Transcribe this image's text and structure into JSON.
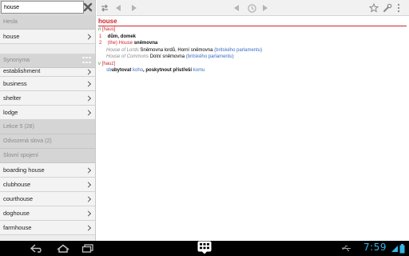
{
  "search": {
    "value": "house"
  },
  "sidebar": {
    "headers": {
      "hesla": "Hesla",
      "synonyma": "Synonyma",
      "lekce": "Lekce 5 (28)",
      "odvozena": "Odvozená slova (2)",
      "slovni": "Slovní spojení"
    },
    "hesla_items": [
      "house"
    ],
    "synonyma_items": [
      "establishment",
      "business",
      "shelter",
      "lodge"
    ],
    "slovni_items": [
      "boarding house",
      "clubhouse",
      "courthouse",
      "doghouse",
      "farmhouse"
    ]
  },
  "entry": {
    "headword": "house",
    "noun": {
      "pos": "n",
      "pron": "[haus]",
      "senses": [
        {
          "num": "1",
          "text": "dům, domek"
        },
        {
          "num": "2",
          "prefix": "(the) House",
          "text": "sněmovna"
        }
      ],
      "phrases": [
        {
          "en": "House of Lords",
          "cz": "Sněmovna lordů, Horní sněmovna",
          "note": "(britského parlamentu)"
        },
        {
          "en": "House of Commons",
          "cz": "Dolní sněmovna",
          "note": "(britského parlamentu)"
        }
      ]
    },
    "verb": {
      "pos": "v",
      "pron": "[hauz]",
      "abbr": "sb",
      "t1": "ubytovat",
      "o1": "koho",
      "t2": ", poskytnout přístřeší",
      "o2": "komu"
    }
  },
  "status": {
    "time": "7:59"
  },
  "colors": {
    "accent": "#d2232a",
    "clock": "#35b5e5",
    "link": "#3b6cc2",
    "pos": "#2e9b2e"
  }
}
